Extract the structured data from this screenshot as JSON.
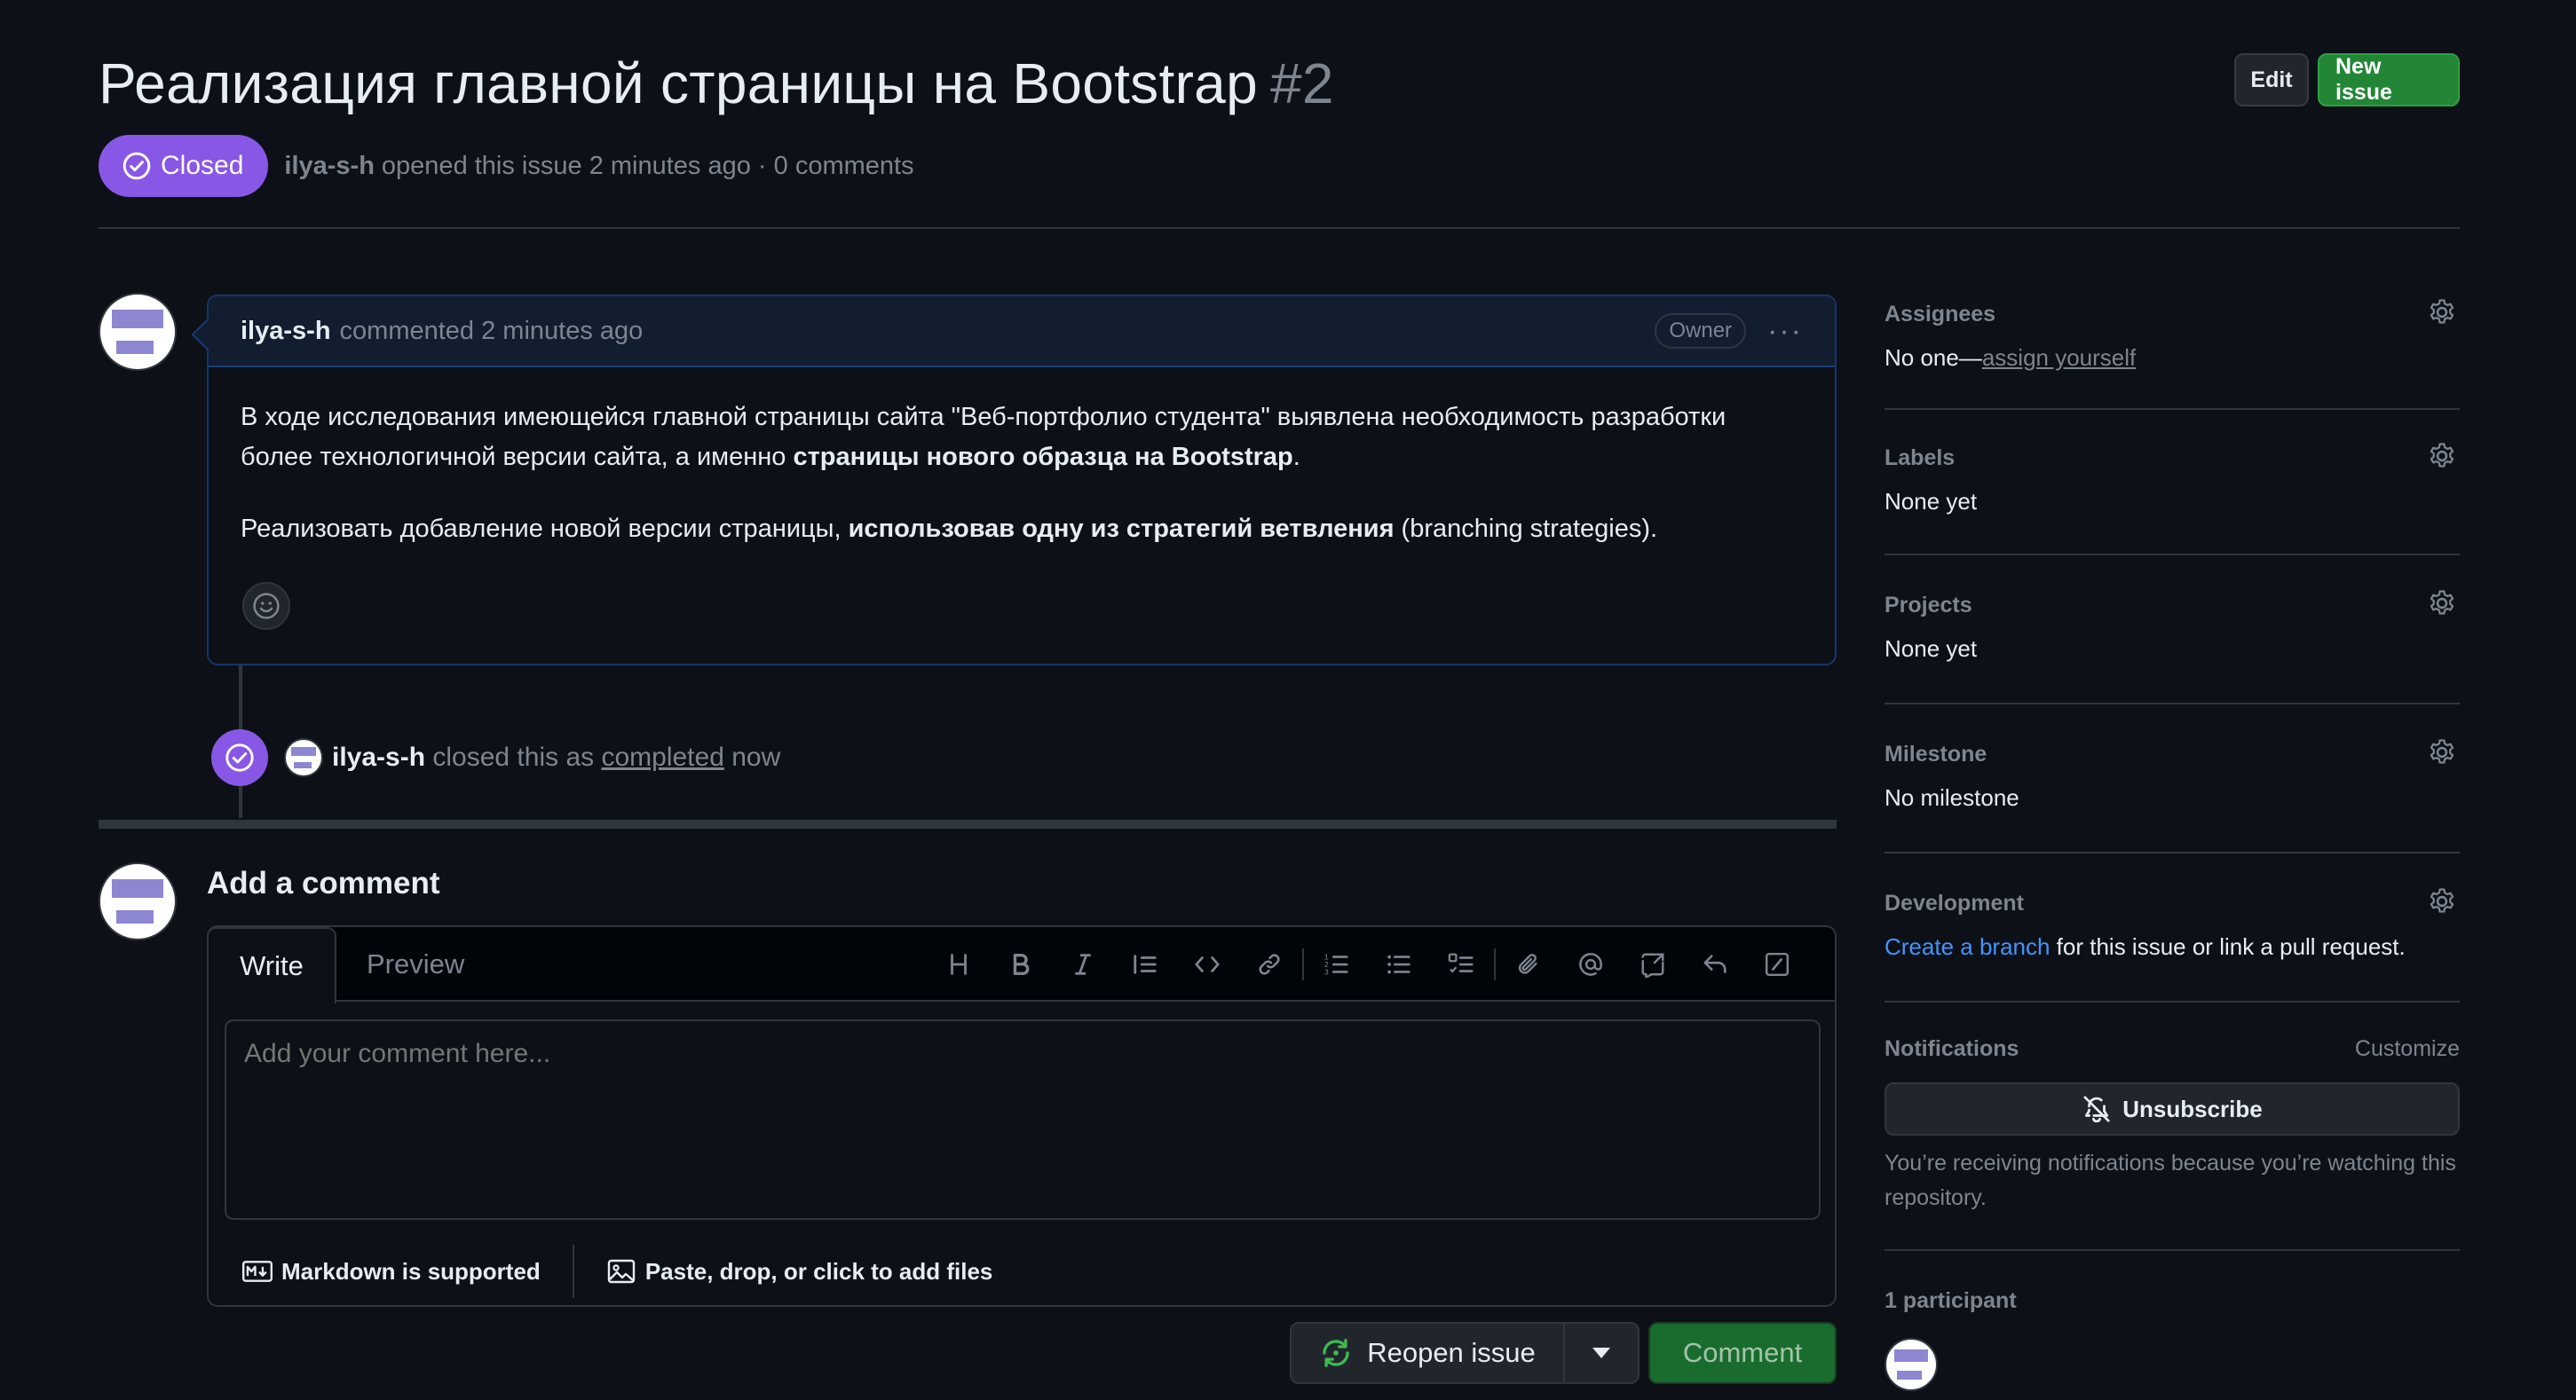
{
  "header": {
    "title": "Реализация главной страницы на Bootstrap",
    "number": "#2",
    "edit_label": "Edit",
    "new_issue_label": "New issue"
  },
  "meta": {
    "status": "Closed",
    "author": "ilya-s-h",
    "summary": "opened this issue 2 minutes ago · 0 comments"
  },
  "comment": {
    "author": "ilya-s-h",
    "time": "commented 2 minutes ago",
    "role_badge": "Owner",
    "para1_a": "В ходе исследования имеющейся главной страницы сайта \"Веб-портфолио студента\" выявлена необходимость разработки более технологичной версии сайта, а именно ",
    "para1_b": "страницы нового образца на Bootstrap",
    "para1_c": ".",
    "para2_a": "Реализовать добавление новой версии страницы, ",
    "para2_b": "использовав одну из стратегий ветвления",
    "para2_c": " (branching strategies)."
  },
  "event": {
    "author": "ilya-s-h",
    "text_pre": " closed this as ",
    "link": "completed",
    "text_post": " now"
  },
  "add_comment": {
    "title": "Add a comment",
    "tab_write": "Write",
    "tab_preview": "Preview",
    "placeholder": "Add your comment here...",
    "markdown_note": "Markdown is supported",
    "files_note": "Paste, drop, or click to add files",
    "reopen_label": "Reopen issue",
    "comment_label": "Comment"
  },
  "sidebar": {
    "assignees": {
      "heading": "Assignees",
      "value": "No one—",
      "link": "assign yourself"
    },
    "labels": {
      "heading": "Labels",
      "value": "None yet"
    },
    "projects": {
      "heading": "Projects",
      "value": "None yet"
    },
    "milestone": {
      "heading": "Milestone",
      "value": "No milestone"
    },
    "development": {
      "heading": "Development",
      "link": "Create a branch",
      "value": " for this issue or link a pull request."
    },
    "notifications": {
      "heading": "Notifications",
      "customize": "Customize",
      "unsubscribe": "Unsubscribe",
      "note": "You’re receiving notifications because you’re watching this repository."
    },
    "participants": {
      "heading": "1 participant"
    }
  },
  "colors": {
    "background": "#0d1117",
    "closed_purple": "#8957e5",
    "green": "#238636",
    "link_blue": "#4493f8"
  }
}
